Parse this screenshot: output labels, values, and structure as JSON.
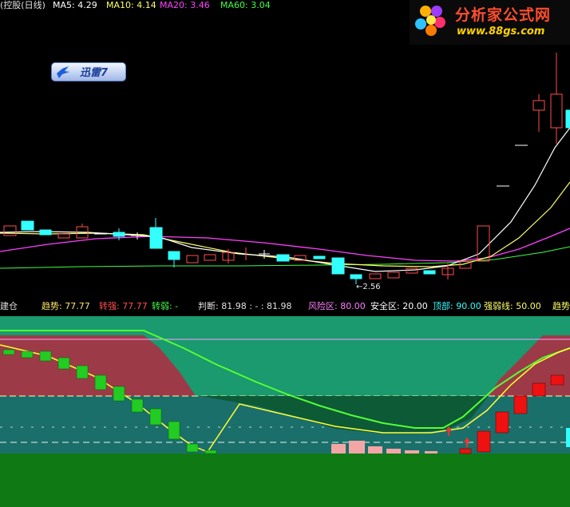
{
  "legend": {
    "title": "(控股(日线)",
    "ma5": "MA5: 4.29",
    "ma10": "MA10: 4.14",
    "ma20": "MA20: 3.46",
    "ma60": "MA60: 3.04"
  },
  "logo": {
    "name": "分析家公式网",
    "url": "www.88gs.com"
  },
  "xunlei": {
    "label": "迅雷7"
  },
  "low_marker": "←2.56",
  "indicator_bar": {
    "build": "建仓",
    "trend": "趋势: 77.77",
    "strong": "转强: 77.77",
    "weak": "转弱: -",
    "judge": "判断: 81.98 : - : 81.98",
    "risk": "风险区: 80.00",
    "safe": "安全区: 20.00",
    "top": "顶部: 90.00",
    "strength": "强弱线: 50.00",
    "trend2": "趋势"
  },
  "colors": {
    "ma5": "#ffffff",
    "ma10": "#ffff00",
    "ma20": "#ff40ff",
    "ma60": "#40ff40",
    "up": "#ff4d4d",
    "down": "#33ffff"
  }
}
